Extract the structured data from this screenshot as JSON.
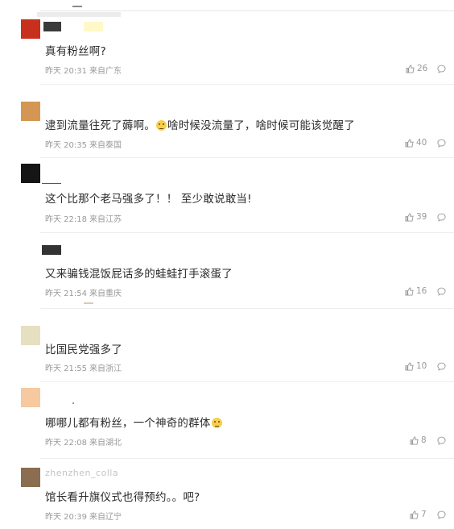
{
  "comments": [
    {
      "text": "真有粉丝啊?",
      "time": "昨天 20:31",
      "location": "来自广东",
      "likes": "26",
      "avatar_color": "#c8301e"
    },
    {
      "text_a": "逮到流量往死了薅啊。",
      "text_b": "啥时候没流量了，啥时候可能该觉醒了",
      "time": "昨天 20:35",
      "location": "来自泰国",
      "likes": "40",
      "avatar_color": "#d49653"
    },
    {
      "text": "这个比那个老马强多了！！ 至少敢说敢当!",
      "time": "昨天 22:18",
      "location": "来自江苏",
      "likes": "39",
      "avatar_color": "#151515"
    },
    {
      "text": "又来骗钱混饭屁话多的蛙蛙打手滚蛋了",
      "time": "昨天 21:54",
      "location": "来自重庆",
      "likes": "16",
      "avatar_color": "#ffffff"
    },
    {
      "text": "比国民党强多了",
      "time": "昨天 21:55",
      "location": "来自浙江",
      "likes": "10",
      "avatar_color": "#e6dfc0"
    },
    {
      "text": "哪哪儿都有粉丝，一个神奇的群体",
      "time": "昨天 22:08",
      "location": "来自湖北",
      "likes": "8",
      "avatar_color": "#f6c9a0"
    },
    {
      "username": "zhenzhen_colla",
      "text": "馆长看升旗仪式也得预约。。吧?",
      "time": "昨天 20:39",
      "location": "来自辽宁",
      "likes": "7",
      "avatar_color": "#8b6d4f"
    }
  ]
}
